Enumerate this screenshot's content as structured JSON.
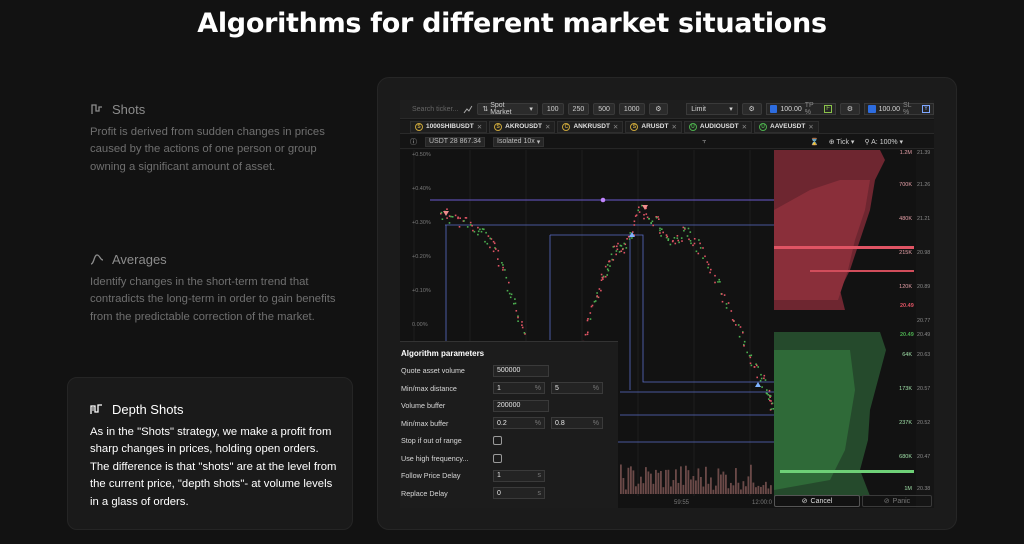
{
  "page": {
    "title": "Algorithms for different market situations"
  },
  "features": [
    {
      "name": "Shots",
      "icon": "shots-icon",
      "description": "Profit is derived from sudden changes in prices caused by the actions of one person or group owning a significant amount of asset."
    },
    {
      "name": "Averages",
      "icon": "averages-icon",
      "description": "Identify changes in the short-term trend that contradicts the long-term in order to gain benefits from the predictable correction of the market."
    },
    {
      "name": "Depth Shots",
      "icon": "depth-shots-icon",
      "description": "As in the \"Shots\" strategy, we make a profit from sharp changes in prices, holding open orders. The difference is that \"shots\" are at the level from the current price, \"depth shots\"- at volume levels in a glass of orders.",
      "active": true
    }
  ],
  "toolbar": {
    "search_placeholder": "Search ticker...",
    "market": "Spot Market",
    "qty_buttons": [
      "100",
      "250",
      "500",
      "1000"
    ],
    "order_type": "Limit",
    "tp_value": "100.00",
    "tp_label": "TP %",
    "tp_tag": "F",
    "sl_value": "100.00",
    "sl_label": "SL %",
    "sl_tag": "Y"
  },
  "tabs": [
    {
      "label": "1000SHIBUSDT",
      "coin": "S"
    },
    {
      "label": "AKROUSDT",
      "coin": "S"
    },
    {
      "label": "ANKRUSDT",
      "coin": "C"
    },
    {
      "label": "ARUSDT",
      "coin": "S"
    },
    {
      "label": "AUDIOUSDT",
      "coin": "U"
    },
    {
      "label": "AAVEUSDT",
      "coin": "U"
    }
  ],
  "subbar": {
    "balance": "USDT 28 867.34",
    "margin": "Isolated 10x",
    "tick": "Tick",
    "zoom": "A: 100%"
  },
  "chart": {
    "pct_labels": [
      "+0.50%",
      "+0.40%",
      "+0.30%",
      "+0.20%",
      "+0.10%",
      "0.00%"
    ],
    "book_volumes": [
      "1.2M",
      "700K",
      "480K",
      "215K",
      "120K",
      "64K",
      "173K",
      "237K",
      "680K",
      "1M"
    ],
    "book_prices": [
      "21.39",
      "21.26",
      "21.21",
      "20.98",
      "20.89",
      "20.77",
      "20.49",
      "20.63",
      "20.57",
      "20.52",
      "20.47",
      "20.38"
    ],
    "price_bid": "20.49",
    "price_ask": "20.49",
    "time_labels": [
      "59:55",
      "12:00:0"
    ]
  },
  "algorithm": {
    "title": "Algorithm parameters",
    "rows": [
      {
        "label": "Quote asset volume",
        "type": "input",
        "value": "500000"
      },
      {
        "label": "Min/max distance",
        "type": "pair",
        "value1": "1",
        "value2": "5",
        "unit": "%"
      },
      {
        "label": "Volume buffer",
        "type": "input",
        "value": "200000"
      },
      {
        "label": "Min/max buffer",
        "type": "pair",
        "value1": "0.2",
        "value2": "0.8",
        "unit": "%"
      },
      {
        "label": "Stop if out of range",
        "type": "check"
      },
      {
        "label": "Use high frequency...",
        "type": "check"
      },
      {
        "label": "Follow Price Delay",
        "type": "input-unit",
        "value": "1",
        "unit": "s"
      },
      {
        "label": "Replace Delay",
        "type": "input-unit",
        "value": "0",
        "unit": "s"
      }
    ]
  },
  "buttons": {
    "cancel": "Cancel",
    "panic": "Panic"
  }
}
